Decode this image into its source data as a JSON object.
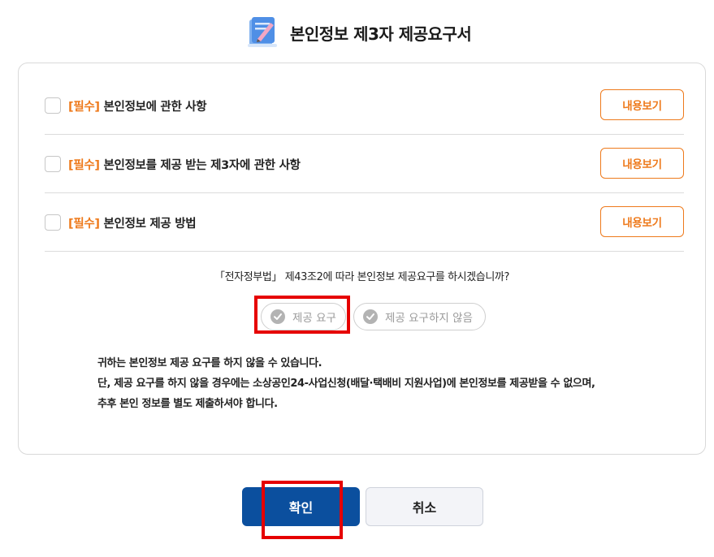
{
  "header": {
    "title": "본인정보 제3자 제공요구서",
    "icon": "document-pen-icon"
  },
  "terms": [
    {
      "required_tag": "[필수]",
      "label": "본인정보에 관한 사항",
      "view_label": "내용보기"
    },
    {
      "required_tag": "[필수]",
      "label": "본인정보를 제공 받는 제3자에 관한 사항",
      "view_label": "내용보기"
    },
    {
      "required_tag": "[필수]",
      "label": "본인정보 제공 방법",
      "view_label": "내용보기"
    }
  ],
  "question": "「전자정부법」 제43조2에 따라 본인정보 제공요구를 하시겠습니까?",
  "choices": {
    "request": "제공 요구",
    "no_request": "제공 요구하지 않음"
  },
  "notice": [
    "귀하는 본인정보 제공 요구를 하지 않을 수 있습니다.",
    "단, 제공 요구를 하지 않을 경우에는 소상공인24-사업신청(배달·택배비 지원사업)에 본인정보를 제공받을 수 없으며,",
    "추후 본인 정보를 별도 제출하셔야 합니다."
  ],
  "buttons": {
    "confirm": "확인",
    "cancel": "취소"
  },
  "colors": {
    "accent_orange": "#ee7a1c",
    "primary_blue": "#0b4f9e",
    "highlight_red": "#e60000"
  }
}
